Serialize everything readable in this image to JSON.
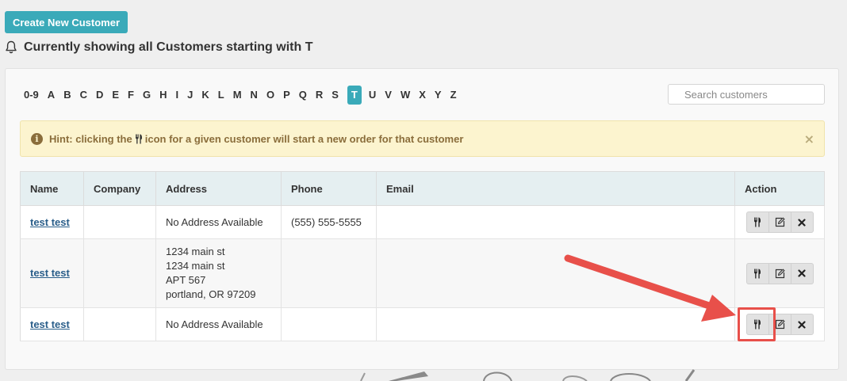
{
  "header": {
    "create_button": "Create New Customer",
    "title": "Currently showing all Customers starting with T",
    "bell_icon": "bell-icon"
  },
  "alphabet": {
    "letters": [
      "0-9",
      "A",
      "B",
      "C",
      "D",
      "E",
      "F",
      "G",
      "H",
      "I",
      "J",
      "K",
      "L",
      "M",
      "N",
      "O",
      "P",
      "Q",
      "R",
      "S",
      "T",
      "U",
      "V",
      "W",
      "X",
      "Y",
      "Z"
    ],
    "active": "T"
  },
  "search": {
    "placeholder": "Search customers",
    "value": ""
  },
  "hint": {
    "prefix": "Hint: clicking the",
    "suffix": "icon for a given customer will start a new order for that customer",
    "info_icon": "info-icon",
    "inline_icon": "fork-knife-icon",
    "close_icon": "close-icon",
    "close_glyph": "×"
  },
  "table": {
    "columns": [
      "Name",
      "Company",
      "Address",
      "Phone",
      "Email",
      "Action"
    ],
    "rows": [
      {
        "name": "test test",
        "company": "",
        "address": [
          "No Address Available"
        ],
        "phone": "(555) 555-5555",
        "email": ""
      },
      {
        "name": "test test",
        "company": "",
        "address": [
          "1234 main st",
          "1234 main st",
          "APT 567",
          "portland, OR 97209"
        ],
        "phone": "",
        "email": ""
      },
      {
        "name": "test test",
        "company": "",
        "address": [
          "No Address Available"
        ],
        "phone": "",
        "email": ""
      }
    ],
    "action_icons": [
      "fork-knife-icon",
      "edit-icon",
      "delete-icon"
    ]
  },
  "colors": {
    "accent": "#3aaab9",
    "hint_bg": "#fcf4cf",
    "hint_text": "#8a6d3b",
    "table_header_bg": "#e5eff1",
    "link": "#2a5e8a",
    "annotation": "#e8504a"
  }
}
